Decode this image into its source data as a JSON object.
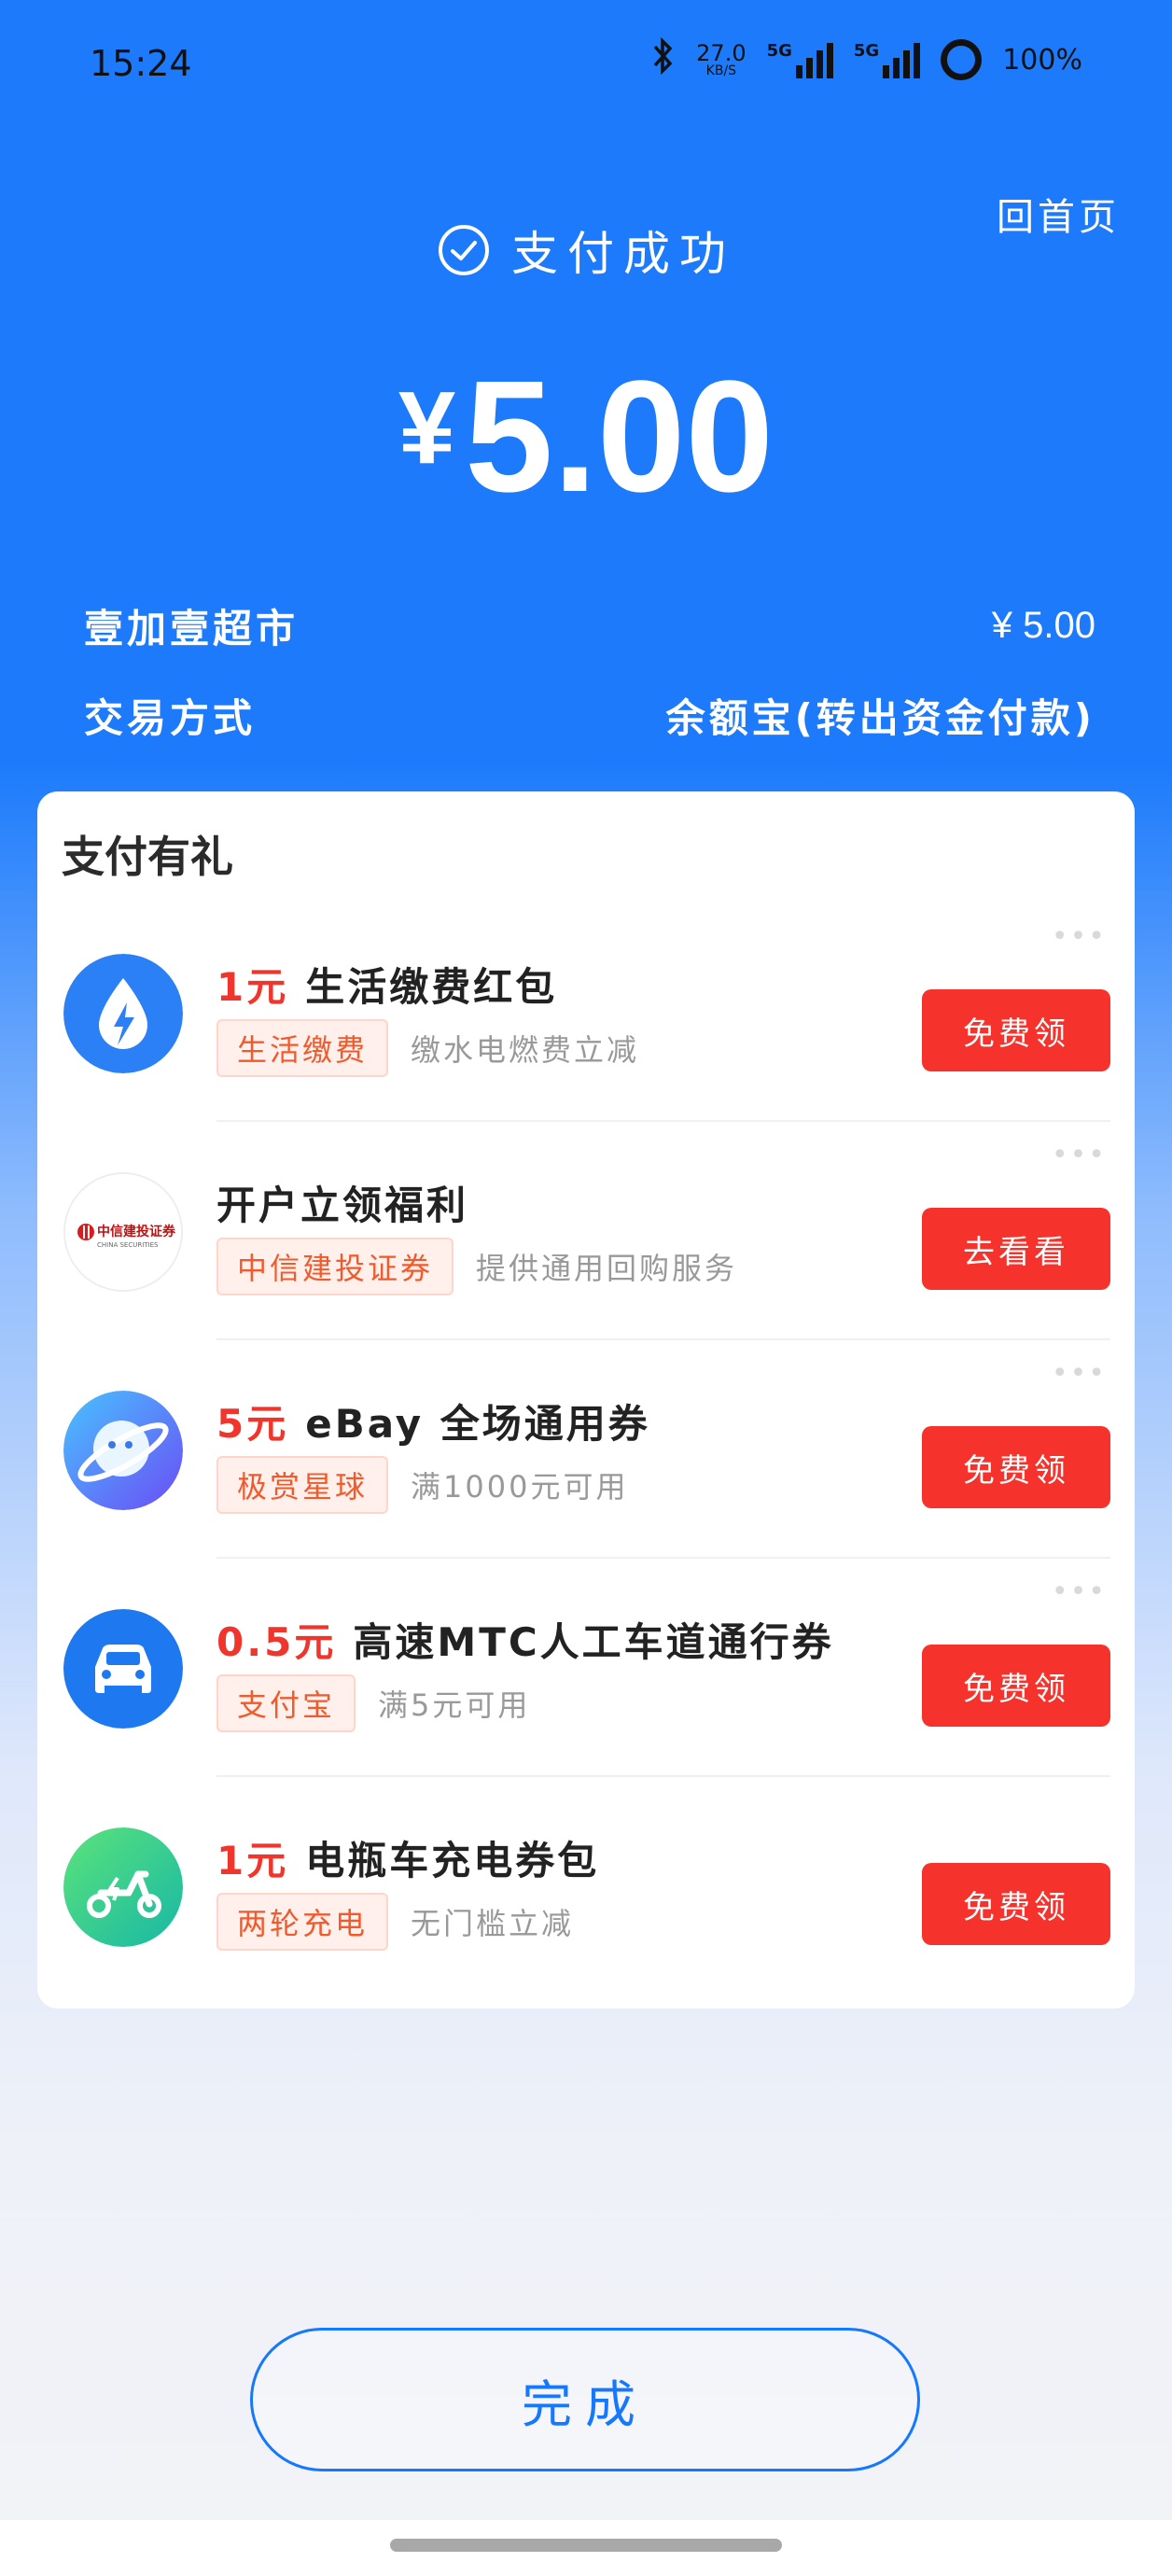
{
  "status_bar": {
    "time": "15:24",
    "speed_value": "27.0",
    "speed_unit": "KB/S",
    "sig1_tag": "5G",
    "sig2_tag": "5G",
    "battery": "100%"
  },
  "header": {
    "home_link": "回首页",
    "pay_status": "支付成功",
    "currency": "¥",
    "amount": "5.00"
  },
  "details": {
    "merchant_label": "壹加壹超市",
    "merchant_amount": "¥ 5.00",
    "method_label": "交易方式",
    "method_value": "余额宝(转出资金付款)"
  },
  "card": {
    "title": "支付有礼",
    "more": "•••",
    "offers": [
      {
        "highlight": "1元",
        "title": "生活缴费红包",
        "tag": "生活缴费",
        "desc": "缴水电燃费立减",
        "button": "免费领",
        "icon": "lightning-drop-icon"
      },
      {
        "highlight": "",
        "title": "开户立领福利",
        "tag": "中信建投证券",
        "desc": "提供通用回购服务",
        "button": "去看看",
        "icon": "china-securities-logo-icon",
        "logo_text": "中信建投证券",
        "logo_sub": "CHINA SECURITIES"
      },
      {
        "highlight": "5元",
        "title": "eBay 全场通用券",
        "tag": "极赏星球",
        "desc": "满1000元可用",
        "button": "免费领",
        "icon": "planet-icon"
      },
      {
        "highlight": "0.5元",
        "title": "高速MTC人工车道通行券",
        "tag": "支付宝",
        "desc": "满5元可用",
        "button": "免费领",
        "icon": "car-icon"
      },
      {
        "highlight": "1元",
        "title": "电瓶车充电券包",
        "tag": "两轮充电",
        "desc": "无门槛立减",
        "button": "免费领",
        "icon": "scooter-icon"
      }
    ]
  },
  "footer": {
    "done_label": "完成"
  },
  "colors": {
    "primary_blue": "#1d7bfb",
    "button_red": "#f5322b",
    "highlight_red": "#f0352c"
  }
}
